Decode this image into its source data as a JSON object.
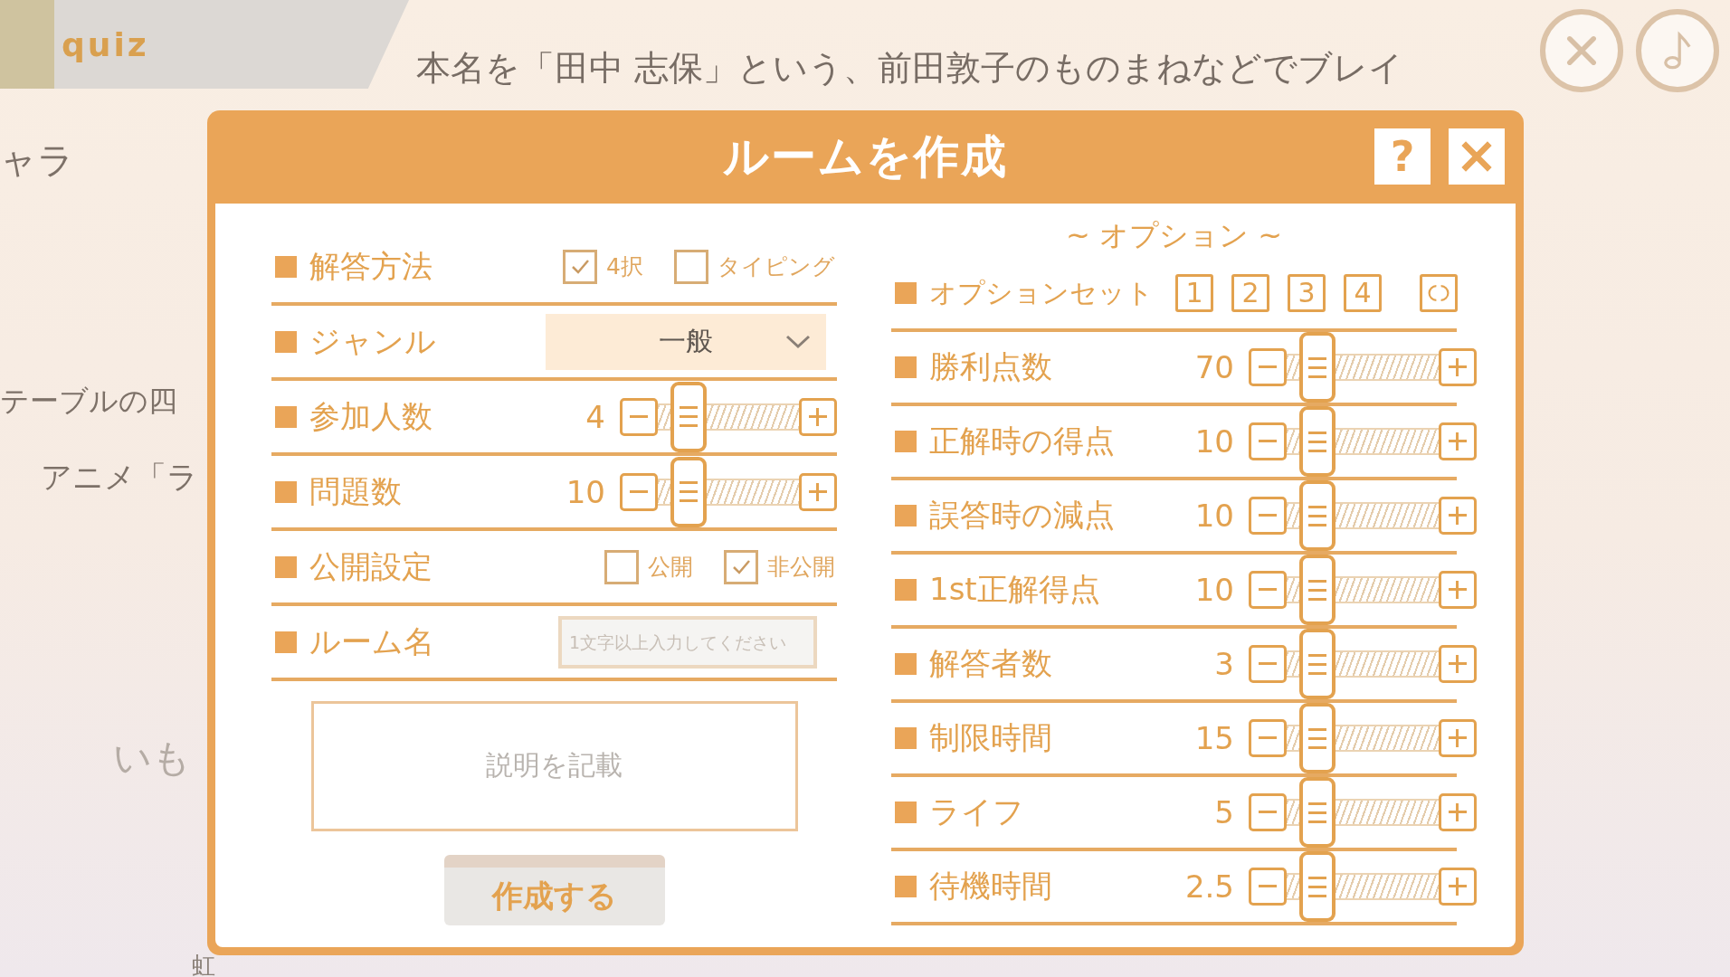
{
  "background": {
    "tab": "quiz",
    "headline": "本名を「田中 志保」という、前田敦子のものまねなどでブレイ",
    "side_texts": [
      {
        "kind": "large",
        "text": "ャラ"
      },
      {
        "kind": "normal",
        "text": "テーブルの四"
      },
      {
        "kind": "indent",
        "text": "アニメ「ラ"
      },
      {
        "kind": "faint",
        "text": "いも"
      },
      {
        "kind": "small",
        "text": "虹"
      }
    ],
    "corner_buttons": [
      {
        "kind": "close"
      },
      {
        "kind": "music"
      }
    ]
  },
  "dialog": {
    "title": "ルームを作成",
    "help": "?",
    "settings": [
      {
        "kind": "checks",
        "label": "解答方法",
        "options": [
          {
            "label": "4択",
            "checked": true
          },
          {
            "label": "タイピング",
            "checked": false
          }
        ]
      },
      {
        "kind": "select",
        "label": "ジャンル",
        "value": "一般"
      },
      {
        "kind": "slider",
        "label": "参加人数",
        "value": "4"
      },
      {
        "kind": "slider",
        "label": "問題数",
        "value": "10"
      },
      {
        "kind": "checks",
        "label": "公開設定",
        "options": [
          {
            "label": "公開",
            "checked": false
          },
          {
            "label": "非公開",
            "checked": true
          }
        ]
      },
      {
        "kind": "input",
        "label": "ルーム名",
        "placeholder": "1文字以上入力してください"
      }
    ],
    "description": {
      "placeholder": "説明を記載"
    },
    "create_button": "作成する",
    "options": {
      "title": "~ オプション ~",
      "set_label": "オプションセット",
      "sets": [
        "1",
        "2",
        "3",
        "4"
      ],
      "rows": [
        {
          "label": "勝利点数",
          "value": "70"
        },
        {
          "label": "正解時の得点",
          "value": "10"
        },
        {
          "label": "誤答時の減点",
          "value": "10"
        },
        {
          "label": "1st正解得点",
          "value": "10"
        },
        {
          "label": "解答者数",
          "value": "3"
        },
        {
          "label": "制限時間",
          "value": "15"
        },
        {
          "label": "ライフ",
          "value": "5"
        },
        {
          "label": "待機時間",
          "value": "2.5"
        }
      ]
    }
  }
}
